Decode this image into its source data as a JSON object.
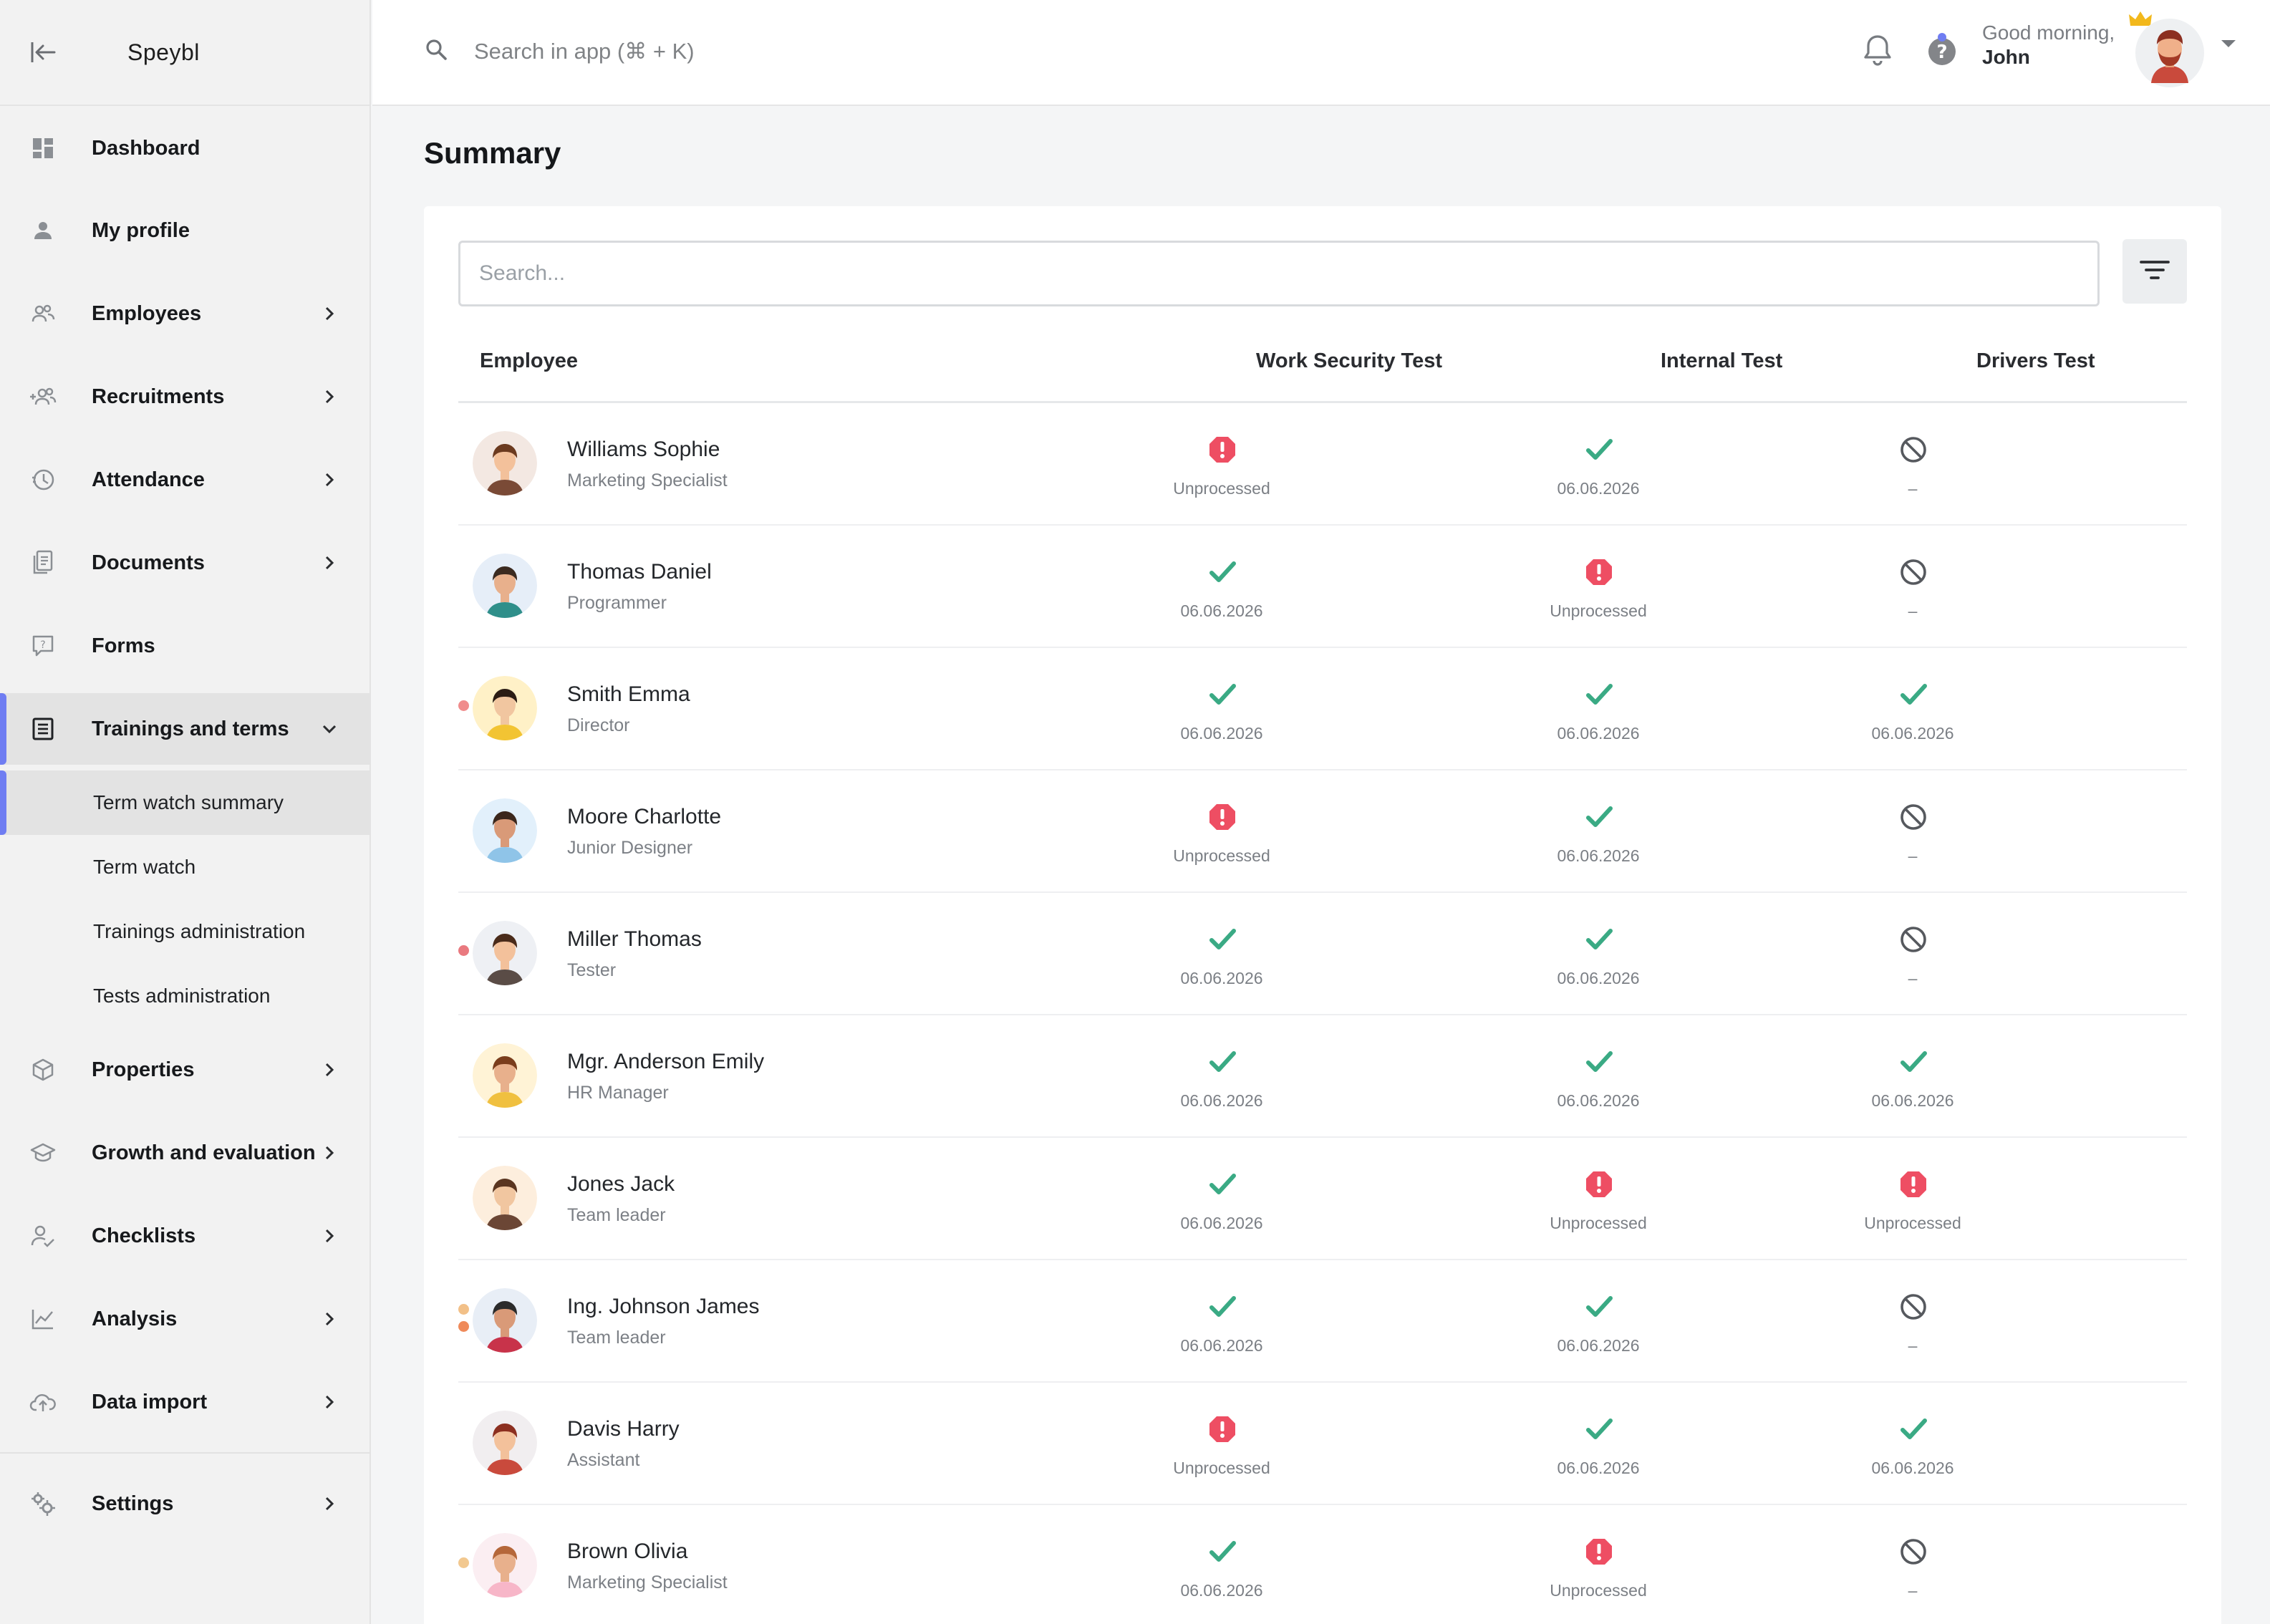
{
  "app": {
    "brand": "Speybl",
    "accent_color": "#6f7df2",
    "success_color": "#3aaa84",
    "danger_color": "#ee4e63"
  },
  "header": {
    "search_placeholder": "Search in app (⌘ + K)",
    "greeting": "Good morning,",
    "user_name": "John"
  },
  "sidebar": {
    "items": [
      {
        "label": "Dashboard",
        "icon": "dashboard-icon"
      },
      {
        "label": "My profile",
        "icon": "person-icon"
      },
      {
        "label": "Employees",
        "icon": "people-icon"
      },
      {
        "label": "Recruitments",
        "icon": "add-people-icon"
      },
      {
        "label": "Attendance",
        "icon": "clock-icon"
      },
      {
        "label": "Documents",
        "icon": "documents-icon"
      },
      {
        "label": "Forms",
        "icon": "form-icon"
      },
      {
        "label": "Trainings and terms",
        "icon": "list-doc-icon"
      },
      {
        "label": "Properties",
        "icon": "box-icon"
      },
      {
        "label": "Growth and evaluation",
        "icon": "graduation-cap-icon"
      },
      {
        "label": "Checklists",
        "icon": "person-check-icon"
      },
      {
        "label": "Analysis",
        "icon": "line-chart-icon"
      },
      {
        "label": "Data import",
        "icon": "cloud-upload-icon"
      },
      {
        "label": "Settings",
        "icon": "gears-icon"
      }
    ],
    "subitems": [
      {
        "label": "Term watch summary"
      },
      {
        "label": "Term watch"
      },
      {
        "label": "Trainings administration"
      },
      {
        "label": "Tests administration"
      }
    ]
  },
  "main": {
    "title": "Summary",
    "search_placeholder": "Search...",
    "columns": [
      "Employee",
      "Work Security Test",
      "Internal Test",
      "Drivers Test"
    ],
    "rows": [
      {
        "name": "Williams Sophie",
        "role": "Marketing Specialist",
        "dots": [],
        "avatar": "woman-headset-avatar",
        "tests": [
          {
            "status": "warning",
            "text": "Unprocessed"
          },
          {
            "status": "ok",
            "text": "06.06.2026"
          },
          {
            "status": "none",
            "text": "–"
          }
        ]
      },
      {
        "name": "Thomas Daniel",
        "role": "Programmer",
        "dots": [],
        "avatar": "man-phone-avatar",
        "tests": [
          {
            "status": "ok",
            "text": "06.06.2026"
          },
          {
            "status": "warning",
            "text": "Unprocessed"
          },
          {
            "status": "none",
            "text": "–"
          }
        ]
      },
      {
        "name": "Smith Emma",
        "role": "Director",
        "dots": [
          "#f08c8c"
        ],
        "avatar": "woman-director-avatar",
        "tests": [
          {
            "status": "ok",
            "text": "06.06.2026"
          },
          {
            "status": "ok",
            "text": "06.06.2026"
          },
          {
            "status": "ok",
            "text": "06.06.2026"
          }
        ]
      },
      {
        "name": "Moore Charlotte",
        "role": "Junior Designer",
        "dots": [],
        "avatar": "woman-curly-avatar",
        "tests": [
          {
            "status": "warning",
            "text": "Unprocessed"
          },
          {
            "status": "ok",
            "text": "06.06.2026"
          },
          {
            "status": "none",
            "text": "–"
          }
        ]
      },
      {
        "name": "Miller Thomas",
        "role": "Tester",
        "dots": [
          "#e9797f"
        ],
        "avatar": "man-tester-avatar",
        "tests": [
          {
            "status": "ok",
            "text": "06.06.2026"
          },
          {
            "status": "ok",
            "text": "06.06.2026"
          },
          {
            "status": "none",
            "text": "–"
          }
        ]
      },
      {
        "name": "Mgr. Anderson Emily",
        "role": "HR Manager",
        "dots": [],
        "avatar": "woman-bun-avatar",
        "tests": [
          {
            "status": "ok",
            "text": "06.06.2026"
          },
          {
            "status": "ok",
            "text": "06.06.2026"
          },
          {
            "status": "ok",
            "text": "06.06.2026"
          }
        ]
      },
      {
        "name": "Jones Jack",
        "role": "Team leader",
        "dots": [],
        "avatar": "man-leader-avatar",
        "tests": [
          {
            "status": "ok",
            "text": "06.06.2026"
          },
          {
            "status": "warning",
            "text": "Unprocessed"
          },
          {
            "status": "warning",
            "text": "Unprocessed"
          }
        ]
      },
      {
        "name": "Ing. Johnson James",
        "role": "Team leader",
        "dots": [
          "#f2c088",
          "#ef8a5a"
        ],
        "avatar": "man-red-shirt-avatar",
        "tests": [
          {
            "status": "ok",
            "text": "06.06.2026"
          },
          {
            "status": "ok",
            "text": "06.06.2026"
          },
          {
            "status": "none",
            "text": "–"
          }
        ]
      },
      {
        "name": "Davis Harry",
        "role": "Assistant",
        "dots": [],
        "avatar": "man-beard-avatar",
        "tests": [
          {
            "status": "warning",
            "text": "Unprocessed"
          },
          {
            "status": "ok",
            "text": "06.06.2026"
          },
          {
            "status": "ok",
            "text": "06.06.2026"
          }
        ]
      },
      {
        "name": "Brown Olivia",
        "role": "Marketing Specialist",
        "dots": [
          "#f2c88f"
        ],
        "avatar": "woman-pink-avatar",
        "tests": [
          {
            "status": "ok",
            "text": "06.06.2026"
          },
          {
            "status": "warning",
            "text": "Unprocessed"
          },
          {
            "status": "none",
            "text": "–"
          }
        ]
      }
    ]
  }
}
